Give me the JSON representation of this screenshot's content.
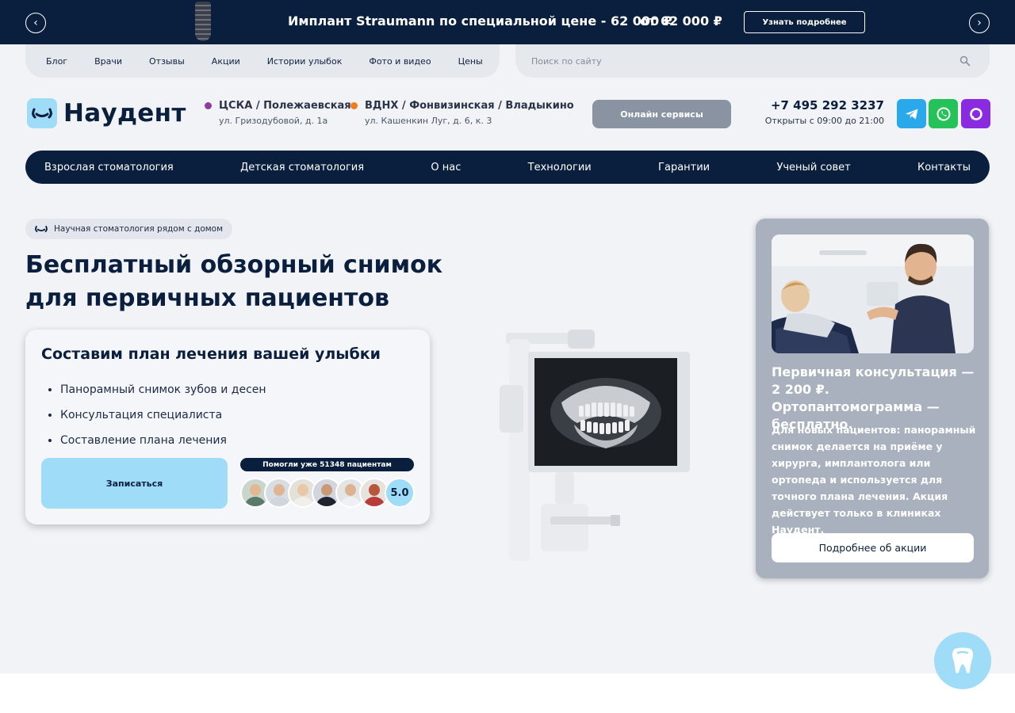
{
  "promo": {
    "title": "Имплант Straumann по специальной цене - 62 000 ₽",
    "price": "от 62 000 ₽",
    "more_label": "Узнать подробнее",
    "prev_icon": "chevron-left-icon",
    "next_icon": "chevron-right-icon"
  },
  "top_links": [
    {
      "label": "Блог"
    },
    {
      "label": "Врачи"
    },
    {
      "label": "Отзывы"
    },
    {
      "label": "Акции"
    },
    {
      "label": "Истории улыбок"
    },
    {
      "label": "Фото и видео"
    },
    {
      "label": "Цены"
    }
  ],
  "search": {
    "placeholder": "Поиск по сайту",
    "icon": "search-icon"
  },
  "logo": {
    "name": "Наудент"
  },
  "clinics": [
    {
      "metro": "ЦСКА / Полежаевская",
      "address": "ул. Гризодубовой, д. 1а",
      "color": "#8e3f9a"
    },
    {
      "metro": "ВДНХ / Фонвизинская / Владыкино",
      "address": "ул. Кашенкин Луг, д. 6, к. 3",
      "color": "#ef7d1a"
    }
  ],
  "online_label": "Онлайн сервисы",
  "contact": {
    "phone": "+7 495 292 3237",
    "hours": "Открыты с 09:00 до 21:00"
  },
  "social": [
    {
      "name": "telegram-icon",
      "color": "#29a9eb"
    },
    {
      "name": "whatsapp-icon",
      "color": "#25c25a"
    },
    {
      "name": "max-messenger-icon",
      "color": "#8a2be2"
    }
  ],
  "nav": [
    {
      "label": "Взрослая стоматология"
    },
    {
      "label": "Детская стоматология"
    },
    {
      "label": "О нас"
    },
    {
      "label": "Технологии"
    },
    {
      "label": "Гарантии"
    },
    {
      "label": "Ученый совет"
    },
    {
      "label": "Контакты"
    }
  ],
  "hero": {
    "badge": "Научная стоматология рядом с домом",
    "title_line1": "Бесплатный обзорный снимок",
    "title_line2": "для первичных пациентов",
    "card": {
      "title": "Составим план лечения вашей улыбки",
      "items": [
        "Панорамный снимок зубов и десен",
        "Консультация специалиста",
        "Составление плана лечения"
      ],
      "cta": "Записаться",
      "helped": "Помогли уже 51348 пациентам",
      "rating": "5.0"
    }
  },
  "offer": {
    "title": "Первичная консультация — 2 200 ₽. Ортопантомограмма — бесплатно.",
    "text": "Для новых пациентов: панорамный снимок делается на приёме у хирурга, имплантолога или ортопеда и используется для точного плана лечения. Акция действует только в клиниках Наудент.",
    "button": "Подробнее об акции"
  },
  "colors": {
    "navy": "#0a1f3d",
    "accent": "#9fdcf7",
    "background": "#f1f3f7"
  }
}
